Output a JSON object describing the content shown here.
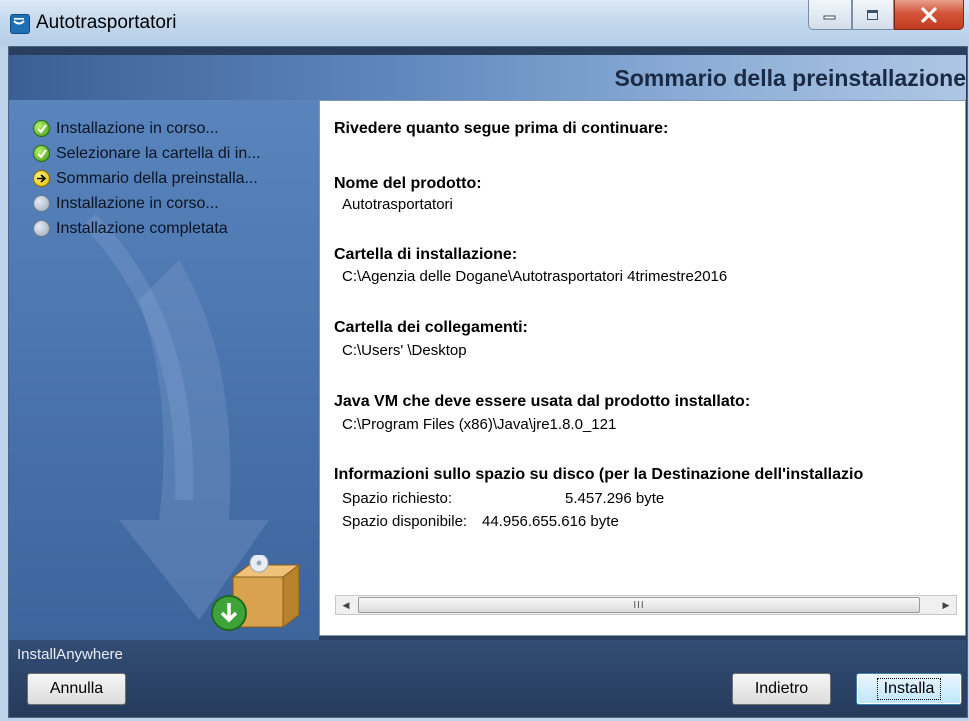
{
  "window": {
    "title": "Autotrasportatori",
    "icon": "installer-app-icon",
    "controls": [
      "minimize-icon",
      "maximize-icon",
      "close-icon"
    ]
  },
  "header": {
    "title": "Sommario della preinstallazione"
  },
  "steps": [
    {
      "label": "Installazione in corso...",
      "status": "done"
    },
    {
      "label": "Selezionare la cartella di in...",
      "status": "done"
    },
    {
      "label": "Sommario della preinstalla...",
      "status": "current"
    },
    {
      "label": "Installazione in corso...",
      "status": "pending"
    },
    {
      "label": "Installazione completata",
      "status": "pending"
    }
  ],
  "summary": {
    "intro": "Rivedere quanto segue prima di continuare:",
    "product_heading": "Nome del prodotto:",
    "product_value": "Autotrasportatori",
    "install_folder_heading": "Cartella di installazione:",
    "install_folder_value": "C:\\Agenzia delle Dogane\\Autotrasportatori 4trimestre2016",
    "shortcut_folder_heading": "Cartella dei collegamenti:",
    "shortcut_folder_value": "C:\\Users' \\Desktop",
    "java_heading": "Java VM che deve essere usata dal prodotto installato:",
    "java_value": "C:\\Program Files (x86)\\Java\\jre1.8.0_121",
    "disk_heading": "Informazioni sullo spazio su disco (per la Destinazione dell'installazio",
    "required_label": "Spazio richiesto:",
    "required_value": "5.457.296 byte",
    "available_label": "Spazio disponibile:",
    "available_value": "44.956.655.616 byte"
  },
  "scrollbar": {
    "thumb_grip": "III"
  },
  "footer": {
    "brand": "InstallAnywhere",
    "cancel_label": "Annulla",
    "back_label": "Indietro",
    "install_label": "Installa"
  },
  "colors": {
    "panel_blue": "#4a74ad",
    "header_dark": "#1b2a44",
    "done_green": "#3c9a14",
    "current_yellow": "#e3b800"
  }
}
